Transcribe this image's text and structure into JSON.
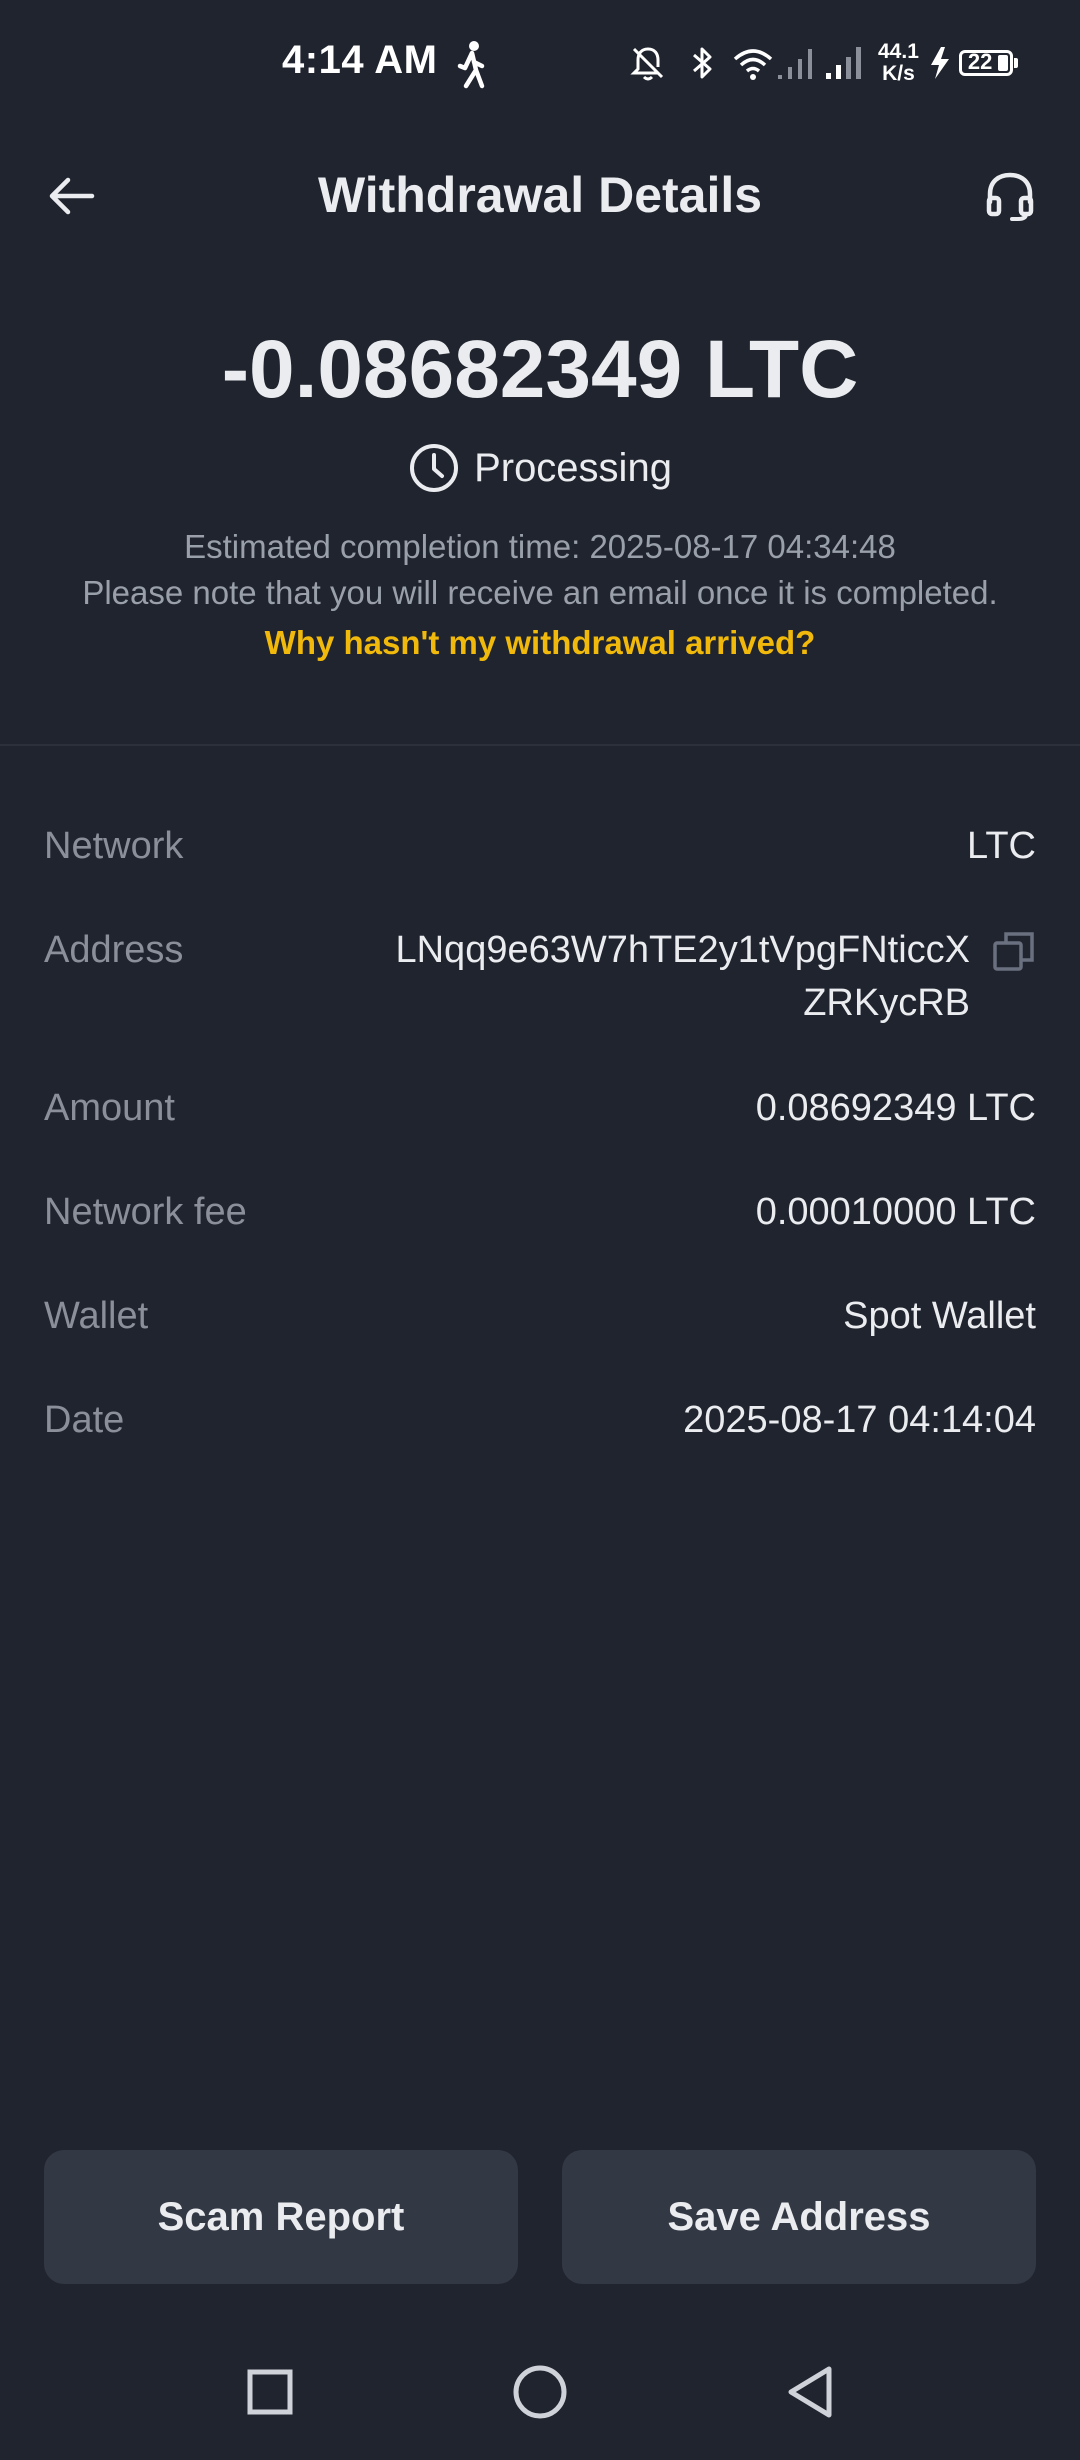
{
  "status_bar": {
    "time": "4:14 AM",
    "speed_value": "44.1",
    "speed_unit": "K/s",
    "battery": "22"
  },
  "header": {
    "title": "Withdrawal Details"
  },
  "summary": {
    "amount": "-0.08682349 LTC",
    "status": "Processing",
    "eta": "Estimated completion time: 2025-08-17 04:34:48",
    "note": "Please note that you will receive an email once it is completed.",
    "help_link": "Why hasn't my withdrawal arrived?"
  },
  "details": {
    "network": {
      "label": "Network",
      "value": "LTC"
    },
    "address": {
      "label": "Address",
      "value": "LNqq9e63W7hTE2y1tVpgFNticcXZRKycRB"
    },
    "amount": {
      "label": "Amount",
      "value": "0.08692349 LTC"
    },
    "fee": {
      "label": "Network fee",
      "value": "0.00010000 LTC"
    },
    "wallet": {
      "label": "Wallet",
      "value": "Spot Wallet"
    },
    "date": {
      "label": "Date",
      "value": "2025-08-17 04:14:04"
    }
  },
  "actions": {
    "scam_report": "Scam Report",
    "save_address": "Save Address"
  },
  "colors": {
    "background": "#20242e",
    "accent": "#f0b90b",
    "button": "#333845",
    "muted_text": "#8a8f99"
  },
  "icons": {
    "back": "arrow-left-icon",
    "support": "headset-icon",
    "status": "clock-icon",
    "copy": "copy-icon"
  }
}
